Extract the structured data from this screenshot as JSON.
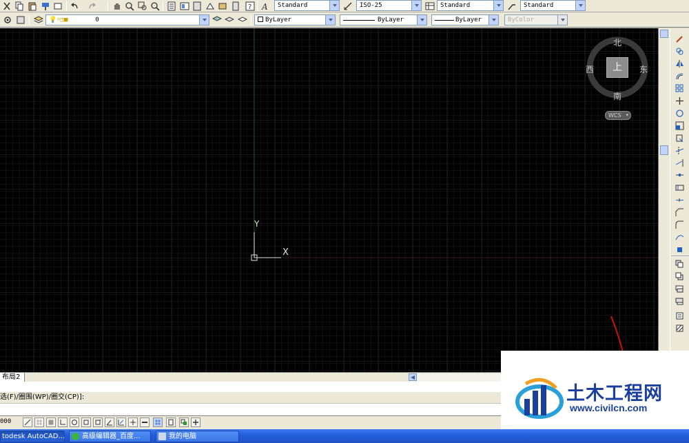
{
  "toolbar_top": {
    "text_style": "Standard",
    "dim_style": "ISO-25",
    "table_style": "Standard",
    "mleader_style": "Standard"
  },
  "toolbar_layers": {
    "layer_name": "0",
    "color": "ByLayer",
    "linetype": "ByLayer",
    "lineweight": "ByLayer",
    "plot_style": "ByColor"
  },
  "viewcube": {
    "north": "北",
    "south": "南",
    "east": "东",
    "west": "西",
    "top_face": "上",
    "wcs_label": "WCS"
  },
  "ucs": {
    "y_label": "Y",
    "x_label": "X"
  },
  "layout_tabs": {
    "active": "布局2"
  },
  "command": {
    "prompt": "选(F)/圈围(WP)/圈交(CP)]:"
  },
  "status": {
    "coords": "000"
  },
  "taskbar": {
    "items": [
      {
        "label": "todesk AutoCAD..."
      },
      {
        "label": "高级编辑器_百度..."
      },
      {
        "label": "我的电脑"
      }
    ]
  },
  "watermark": {
    "title": "土木工程网",
    "url": "www.civilcn.com"
  },
  "colors": {
    "canvas_bg": "#000000",
    "grid_minor": "#1e1e1e",
    "grid_major": "#2f2f2f",
    "y_axis_line": "#1f4a1f",
    "annotation_red": "#d01010",
    "watermark_blue": "#1a3f9e"
  }
}
